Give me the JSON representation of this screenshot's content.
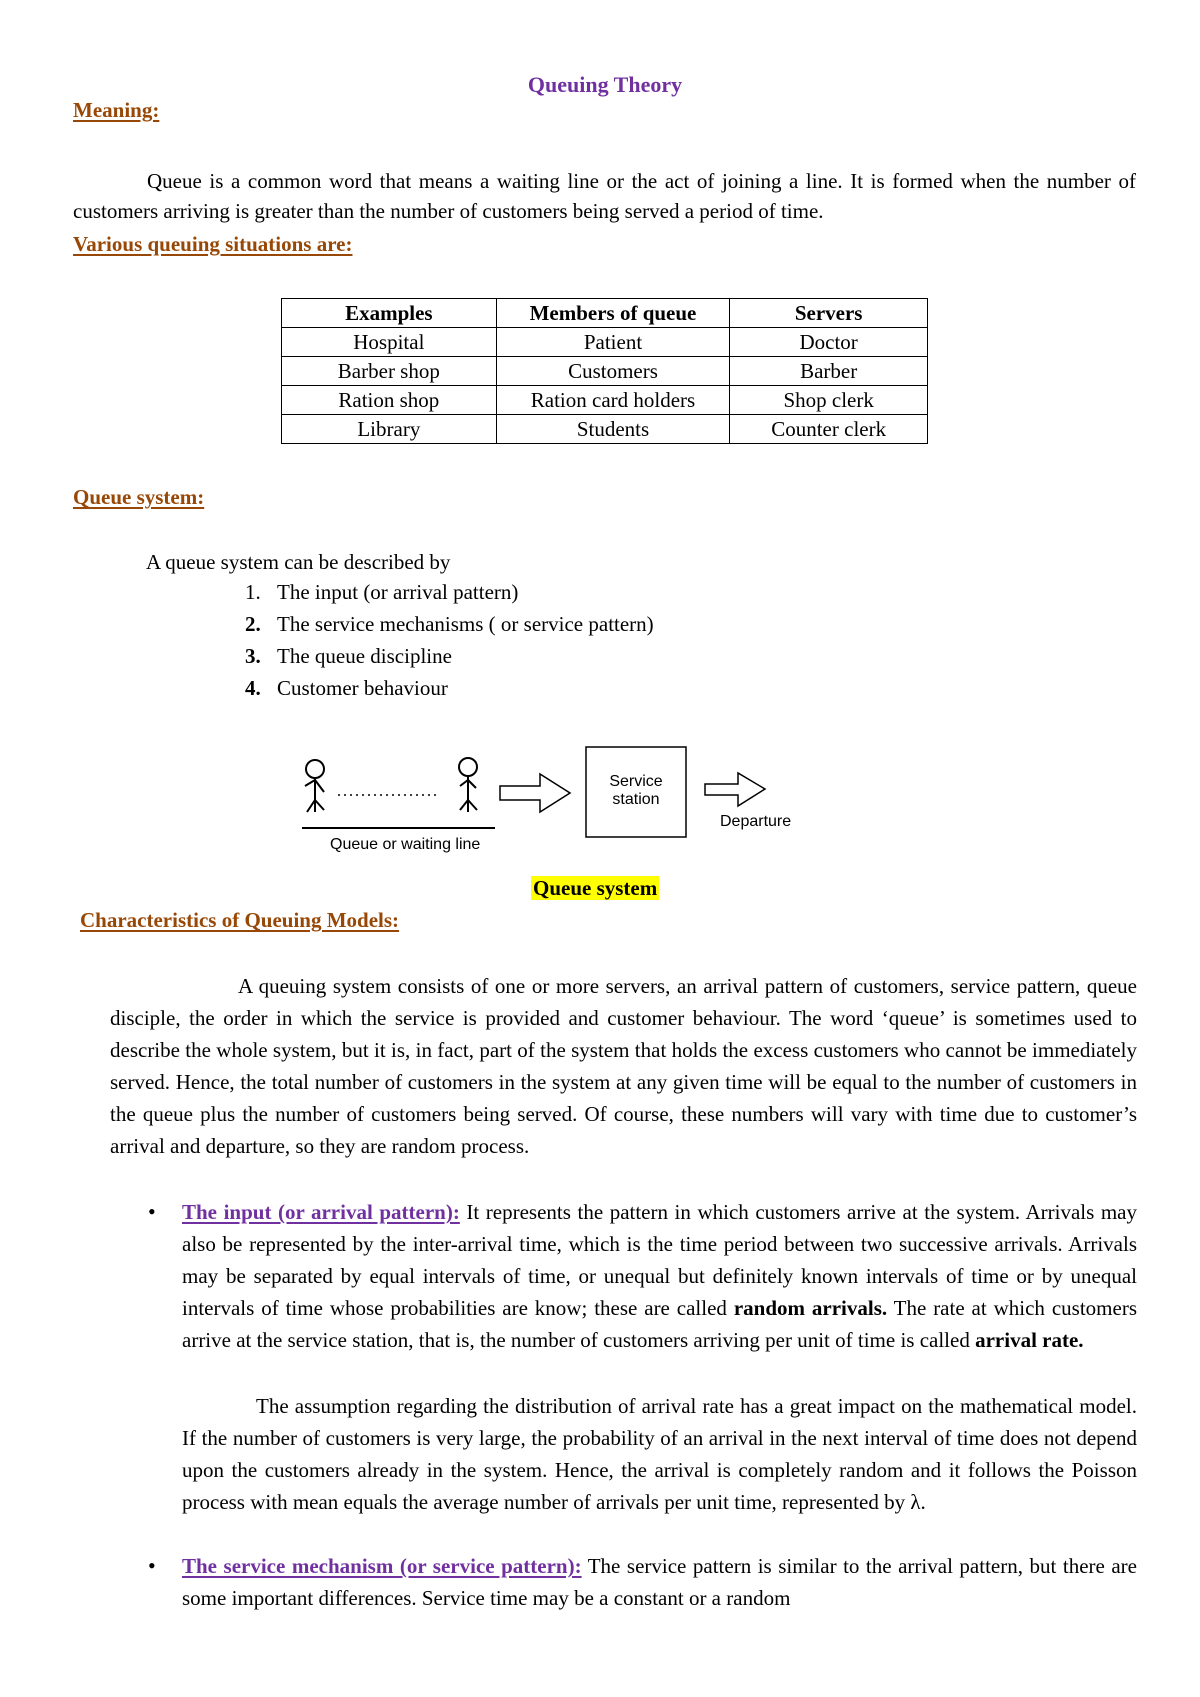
{
  "document": {
    "title": "Queuing Theory",
    "meaning": {
      "heading": "Meaning:",
      "paragraph": "Queue is a common word that means a waiting line or the act of joining a line. It is formed when the number of customers arriving is greater than the number of customers being served a period of time."
    },
    "situations": {
      "heading": "Various queuing situations are:",
      "table": {
        "headers": [
          "Examples",
          "Members of queue",
          "Servers"
        ],
        "rows": [
          [
            "Hospital",
            "Patient",
            "Doctor"
          ],
          [
            "Barber shop",
            "Customers",
            "Barber"
          ],
          [
            "Ration shop",
            "Ration card holders",
            "Shop clerk"
          ],
          [
            "Library",
            "Students",
            "Counter clerk"
          ]
        ]
      }
    },
    "queue_system": {
      "heading": "Queue system:",
      "intro": "A queue system can be described by",
      "items": [
        {
          "num": "1.",
          "text": "The input (or arrival pattern)"
        },
        {
          "num": "2.",
          "text": "The service mechanisms ( or service pattern)"
        },
        {
          "num": "3.",
          "text": "The queue discipline"
        },
        {
          "num": "4.",
          "text": "Customer behaviour"
        }
      ],
      "diagram": {
        "queue_label": "Queue or waiting line",
        "station_label_line1": "Service",
        "station_label_line2": "station",
        "departure_label": "Departure"
      },
      "caption": "Queue system"
    },
    "characteristics": {
      "heading": "Characteristics of Queuing Models:",
      "paragraph": "A queuing system consists of one or more servers, an arrival pattern of customers, service pattern, queue disciple, the order in which the service is provided and customer behaviour. The word ‘queue’ is sometimes used to describe the whole system, but it is, in fact, part of the system that holds the excess customers who cannot be immediately served. Hence, the total number of customers in the system at any given time will be equal to the number of customers in the queue plus the number of customers being served. Of course, these numbers will vary with time due to customer’s arrival and departure, so they are random process.",
      "bullets": [
        {
          "head": "The input (or arrival pattern):",
          "text_1": " It represents the pattern in which customers arrive at the system. Arrivals may also be represented by the inter-arrival time, which is the time period between two successive arrivals. Arrivals may be separated by equal intervals of time, or unequal but definitely known intervals of time or by unequal intervals of time whose probabilities are know; these are called ",
          "bold_1": "random arrivals.",
          "text_2": " The rate at which customers arrive at the service station, that is, the number of customers arriving per unit of time is called ",
          "bold_2": "arrival rate.",
          "continuation": "The assumption regarding the distribution of arrival rate has a great impact on the mathematical model. If the number of customers is very large, the probability of an arrival in the next interval of time does not depend upon the customers already in the system. Hence, the arrival is completely random and it follows the Poisson process with mean equals the average number of arrivals per unit time, represented by λ."
        },
        {
          "head": "The service mechanism (or service pattern):",
          "text_1": " The service pattern is similar to the arrival pattern, but there are some important differences. Service time may be a constant or a random"
        }
      ],
      "bullet_glyph": "•"
    }
  }
}
